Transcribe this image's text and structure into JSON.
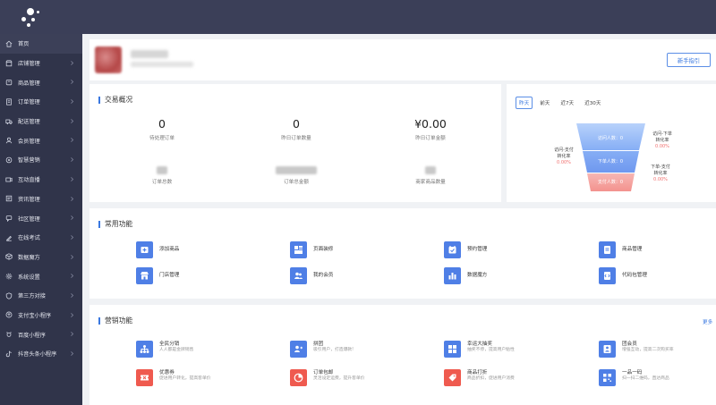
{
  "sidebar": {
    "items": [
      {
        "label": "首页",
        "icon": "home-icon"
      },
      {
        "label": "店铺管理",
        "icon": "store-icon"
      },
      {
        "label": "商品管理",
        "icon": "goods-icon"
      },
      {
        "label": "订单管理",
        "icon": "order-icon"
      },
      {
        "label": "配送管理",
        "icon": "delivery-icon"
      },
      {
        "label": "会员管理",
        "icon": "member-icon"
      },
      {
        "label": "智慧营销",
        "icon": "marketing-icon"
      },
      {
        "label": "互动直播",
        "icon": "live-icon"
      },
      {
        "label": "资讯管理",
        "icon": "news-icon"
      },
      {
        "label": "社区管理",
        "icon": "community-icon"
      },
      {
        "label": "在线考试",
        "icon": "exam-icon"
      },
      {
        "label": "数据魔方",
        "icon": "data-cube-icon"
      },
      {
        "label": "系统设置",
        "icon": "settings-icon"
      },
      {
        "label": "第三方对接",
        "icon": "shield-icon"
      },
      {
        "label": "支付宝小程序",
        "icon": "alipay-icon"
      },
      {
        "label": "百度小程序",
        "icon": "baidu-icon"
      },
      {
        "label": "抖音头条小程序",
        "icon": "douyin-icon"
      }
    ]
  },
  "header": {
    "guide_button": "新手指引"
  },
  "trade": {
    "title": "交易概况",
    "stats": [
      {
        "value": "0",
        "label": "待处理订单"
      },
      {
        "value": "0",
        "label": "昨日订单数量"
      },
      {
        "value": "¥0.00",
        "label": "昨日订单金额"
      },
      {
        "label": "订单总数"
      },
      {
        "label": "订单总金额"
      },
      {
        "label": "商家商品数量"
      }
    ]
  },
  "period_tabs": [
    "昨天",
    "前天",
    "近7天",
    "近30天"
  ],
  "funnel": {
    "levels": [
      "访问人数：0",
      "下单人数：0",
      "支付人数：0"
    ],
    "left": {
      "line1": "访问-支付",
      "line2": "转化率",
      "pct": "0.00%"
    },
    "right_top": {
      "line1": "访问-下单",
      "line2": "转化率",
      "pct": "0.00%"
    },
    "right_bottom": {
      "line1": "下单-支付",
      "line2": "转化率",
      "pct": "0.00%"
    },
    "colors": {
      "top": "#8ab4f7",
      "middle": "#6f9af0",
      "bottom": "#f6a2a0"
    }
  },
  "common": {
    "title": "常用功能",
    "items": [
      {
        "label": "添加商品",
        "icon": "add-goods-icon",
        "color": "#4f7fe6"
      },
      {
        "label": "页面装修",
        "icon": "page-design-icon",
        "color": "#4f7fe6"
      },
      {
        "label": "预约管理",
        "icon": "booking-icon",
        "color": "#4f7fe6"
      },
      {
        "label": "商品管理",
        "icon": "goods-manage-icon",
        "color": "#4f7fe6"
      },
      {
        "label": "门店管理",
        "icon": "shop-icon",
        "color": "#4f7fe6"
      },
      {
        "label": "我的会员",
        "icon": "vip-icon",
        "color": "#4f7fe6"
      },
      {
        "label": "数据魔方",
        "icon": "chart-icon",
        "color": "#4f7fe6"
      },
      {
        "label": "代码包管理",
        "icon": "code-icon",
        "color": "#4f7fe6"
      }
    ]
  },
  "marketing": {
    "title": "营销功能",
    "more": "更多",
    "items": [
      {
        "label": "全民分销",
        "desc": "人人都是金牌销售",
        "icon": "distribution-icon",
        "color": "#4f7fe6"
      },
      {
        "label": "拼团",
        "desc": "吸引用户，打造爆款!",
        "icon": "group-buy-icon",
        "color": "#4f7fe6"
      },
      {
        "label": "幸运大抽奖",
        "desc": "抽奖不停，提高用户粘性",
        "icon": "lottery-icon",
        "color": "#4f7fe6"
      },
      {
        "label": "团会员",
        "desc": "增强互动，提高二次购买率",
        "icon": "team-member-icon",
        "color": "#4f7fe6"
      },
      {
        "label": "优惠券",
        "desc": "促进用户转化，提高客单价",
        "icon": "coupon-icon",
        "color": "#ef5a4f"
      },
      {
        "label": "订单包邮",
        "desc": "灵活设定运费，提升客单价",
        "icon": "free-shipping-icon",
        "color": "#ef5a4f"
      },
      {
        "label": "商品打折",
        "desc": "商品折扣，促进用户消费",
        "icon": "discount-icon",
        "color": "#ef5a4f"
      },
      {
        "label": "一品一码",
        "desc": "扫一扫二维码，直达商品",
        "icon": "qrcode-icon",
        "color": "#4f7fe6"
      }
    ]
  }
}
